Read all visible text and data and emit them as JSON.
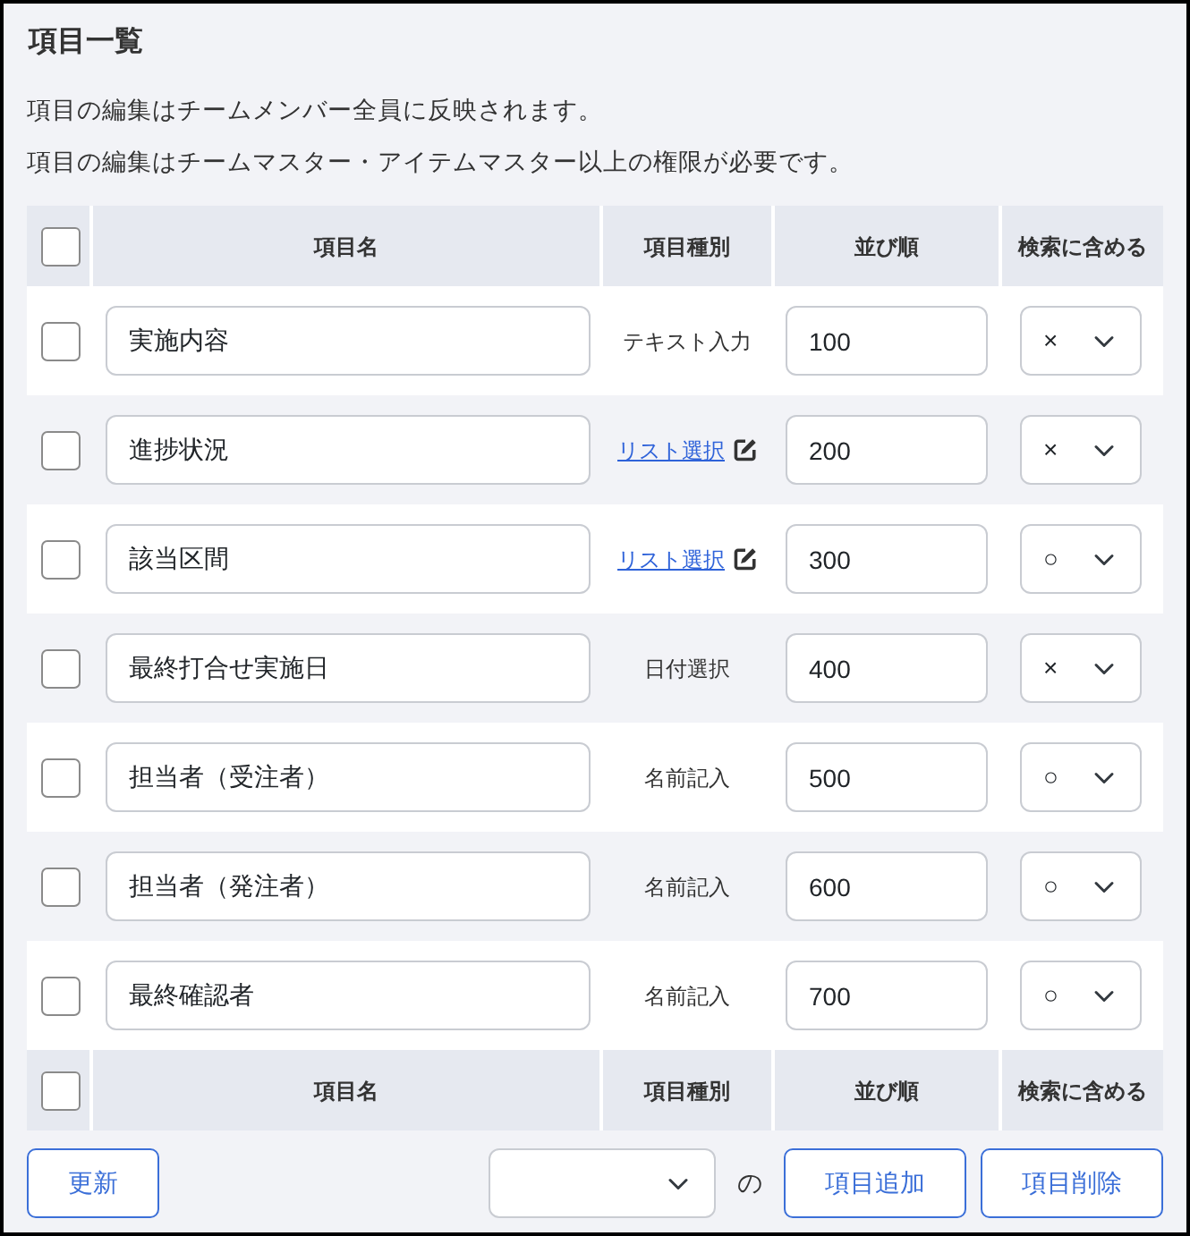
{
  "title": "項目一覧",
  "notes": [
    "項目の編集はチームメンバー全員に反映されます。",
    "項目の編集はチームマスター・アイテムマスター以上の権限が必要です。"
  ],
  "table": {
    "header": {
      "checked": false,
      "columns": [
        "項目名",
        "項目種別",
        "並び順",
        "検索に含める"
      ]
    },
    "rows": [
      {
        "checked": false,
        "name": "実施内容",
        "type": {
          "kind": "text",
          "label": "テキスト入力"
        },
        "order": "100",
        "search": "×"
      },
      {
        "checked": false,
        "name": "進捗状況",
        "type": {
          "kind": "link",
          "label": "リスト選択"
        },
        "order": "200",
        "search": "×"
      },
      {
        "checked": false,
        "name": "該当区間",
        "type": {
          "kind": "link",
          "label": "リスト選択"
        },
        "order": "300",
        "search": "○"
      },
      {
        "checked": false,
        "name": "最終打合せ実施日",
        "type": {
          "kind": "text",
          "label": "日付選択"
        },
        "order": "400",
        "search": "×"
      },
      {
        "checked": false,
        "name": "担当者（受注者）",
        "type": {
          "kind": "text",
          "label": "名前記入"
        },
        "order": "500",
        "search": "○"
      },
      {
        "checked": false,
        "name": "担当者（発注者）",
        "type": {
          "kind": "text",
          "label": "名前記入"
        },
        "order": "600",
        "search": "○"
      },
      {
        "checked": false,
        "name": "最終確認者",
        "type": {
          "kind": "text",
          "label": "名前記入"
        },
        "order": "700",
        "search": "○"
      }
    ],
    "footer": {
      "checked": false,
      "columns": [
        "項目名",
        "項目種別",
        "並び順",
        "検索に含める"
      ]
    }
  },
  "actions": {
    "update_button": "更新",
    "position_label": "の",
    "buttons": [
      "項目追加",
      "項目削除"
    ]
  }
}
